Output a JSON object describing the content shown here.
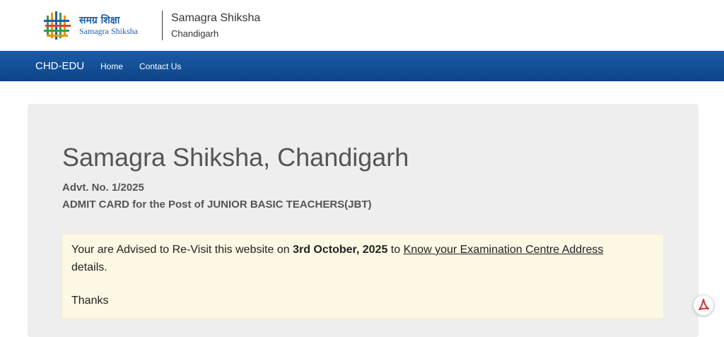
{
  "header": {
    "logo_hindi": "समग्र शिक्षा",
    "logo_english": "Samagra Shiksha",
    "site_title": "Samagra Shiksha",
    "site_subtitle": "Chandigarh"
  },
  "nav": {
    "brand": "CHD-EDU",
    "items": [
      {
        "label": "Home"
      },
      {
        "label": "Contact Us"
      }
    ]
  },
  "main": {
    "title": "Samagra Shiksha, Chandigarh",
    "advt": "Advt. No. 1/2025",
    "post": "ADMIT CARD for the Post of JUNIOR BASIC TEACHERS(JBT)"
  },
  "alert": {
    "text_before": "Your are Advised to Re-Visit this website on ",
    "date": "3rd October, 2025",
    "text_middle": " to ",
    "link": "Know your Examination Centre Address",
    "text_after": "details.",
    "thanks": "Thanks"
  },
  "icons": {
    "pdf": "pdf-icon",
    "logo": "samagra-shiksha-logo-icon"
  },
  "colors": {
    "navbar": "#1a5ba8",
    "jumbotron": "#eeeeee",
    "alert_bg": "#fcf8e3",
    "pdf_red": "#d32f2f"
  }
}
